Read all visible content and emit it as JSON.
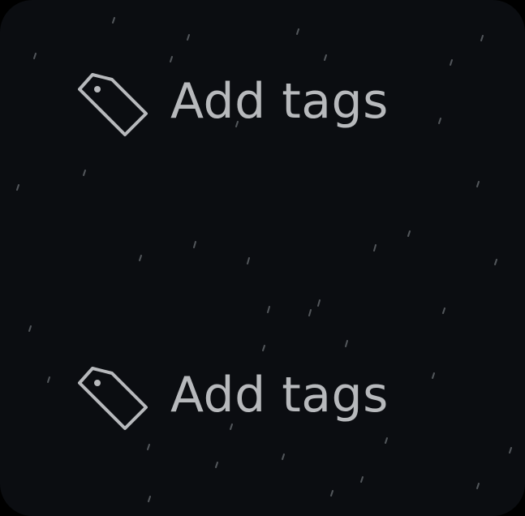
{
  "theme": {
    "background": "#0b0d11",
    "text_color": "#b7b9bc",
    "icon_color": "#b7b9bc"
  },
  "tag_buttons": [
    {
      "label": "Add tags",
      "icon": "tag-icon"
    },
    {
      "label": "Add tags",
      "icon": "tag-icon"
    }
  ]
}
